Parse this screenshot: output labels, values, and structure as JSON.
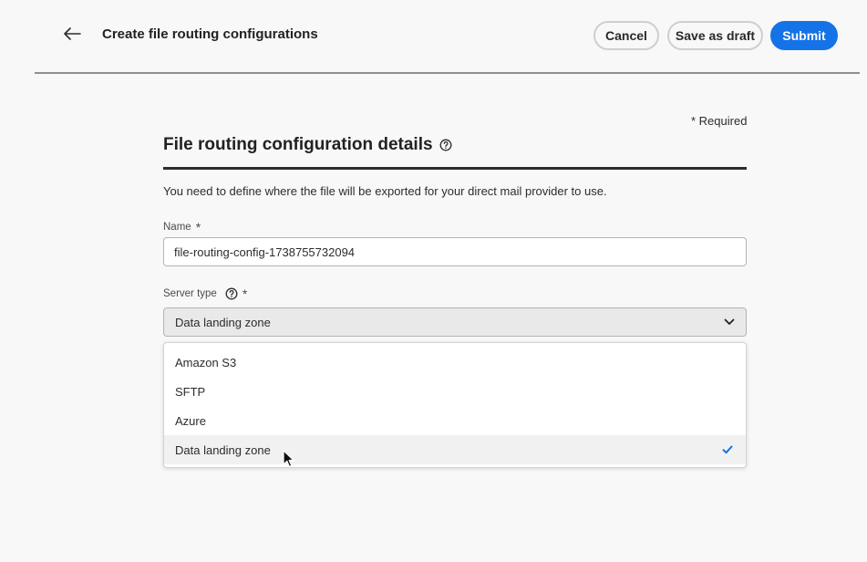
{
  "header": {
    "title": "Create file routing configurations",
    "cancel_label": "Cancel",
    "draft_label": "Save as draft",
    "submit_label": "Submit",
    "back_icon": "arrow-left-icon"
  },
  "form": {
    "required_note": "* Required",
    "section_title": "File routing configuration details",
    "description": "You need to define where the file will be exported for your direct mail provider to use.",
    "name_label": "Name",
    "name_value": "file-routing-config-1738755732094",
    "server_type_label": "Server type",
    "server_type_value": "Data landing zone",
    "required_marker": "*"
  },
  "dropdown": {
    "options": [
      {
        "label": "Amazon S3",
        "selected": false
      },
      {
        "label": "SFTP",
        "selected": false
      },
      {
        "label": "Azure",
        "selected": false
      },
      {
        "label": "Data landing zone",
        "selected": true
      }
    ]
  },
  "colors": {
    "accent": "#1473e6",
    "background": "#f8f8f8"
  }
}
